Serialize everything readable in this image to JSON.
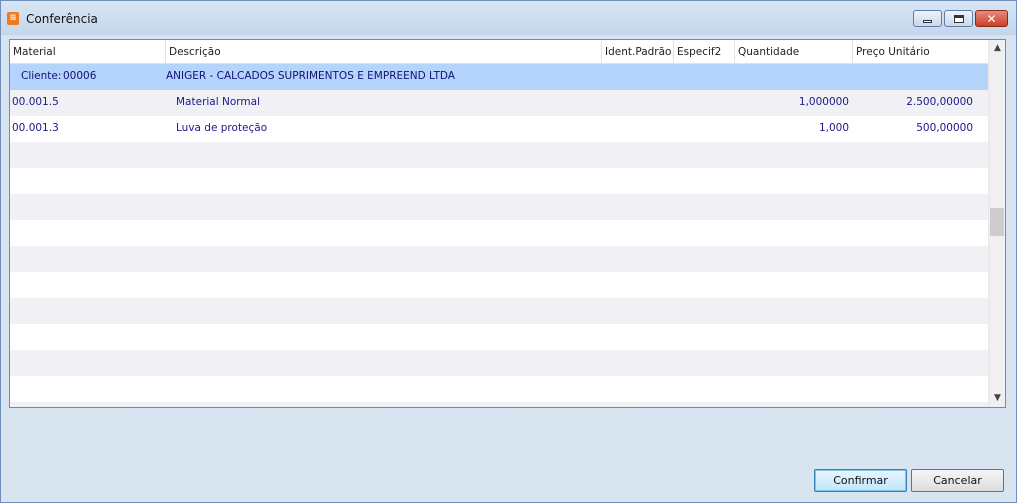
{
  "window": {
    "title": "Conferência",
    "app_icon": "app-logo-icon",
    "controls": {
      "minimize": "minimize-icon",
      "maximize": "maximize-icon",
      "close": "close-icon"
    }
  },
  "grid": {
    "columns": [
      "Material",
      "Descrição",
      "Ident.Padrão",
      "Especif2",
      "Quantidade",
      "Preço Unitário"
    ],
    "group": {
      "label": "Cliente:",
      "code": "00006",
      "name": "ANIGER - CALCADOS SUPRIMENTOS E EMPREEND LTDA"
    },
    "rows": [
      {
        "material": "00.001.5",
        "descricao": "Material Normal",
        "quantidade": "1,000000",
        "preco": "2.500,00000"
      },
      {
        "material": "00.001.3",
        "descricao": "Luva de proteção",
        "quantidade": "1,000",
        "preco": "500,00000"
      }
    ]
  },
  "buttons": {
    "confirm": "Confirmar",
    "cancel": "Cancelar"
  },
  "colors": {
    "group_bg": "#b5d4fb",
    "row_text": "#1a1a8c"
  }
}
